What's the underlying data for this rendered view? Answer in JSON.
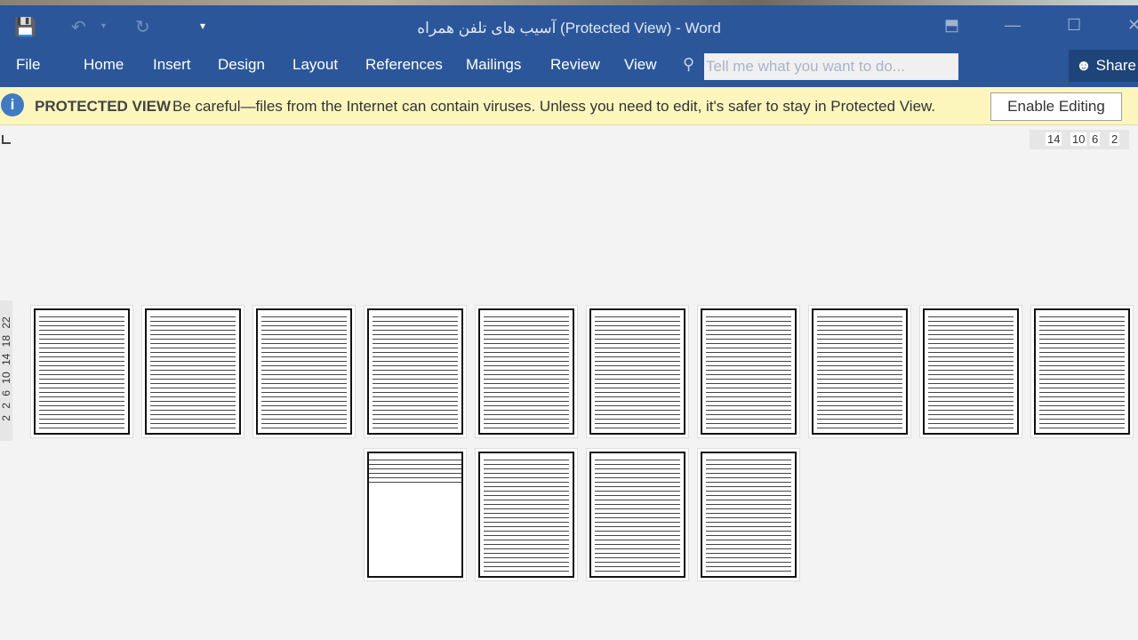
{
  "window": {
    "title": "آسیب های تلفن همراه (Protected View) - Word"
  },
  "quick_access": {
    "save": "save-icon",
    "undo": "undo-icon",
    "redo": "redo-icon",
    "customize": "customize-icon"
  },
  "ribbon": {
    "tabs": [
      "File",
      "Home",
      "Insert",
      "Design",
      "Layout",
      "References",
      "Mailings",
      "Review",
      "View"
    ],
    "tell_me_placeholder": "Tell me what you want to do...",
    "share_label": "Share"
  },
  "protected_view": {
    "label": "PROTECTED VIEW",
    "message": "Be careful—files from the Internet can contain viruses. Unless you need to edit, it's safer to stay in Protected View.",
    "button": "Enable Editing"
  },
  "rulers": {
    "horizontal": [
      "14",
      "10",
      "6",
      "2"
    ],
    "vertical": "2 2 6 10 14 18 22"
  },
  "document": {
    "page_count": 14,
    "accent": "#2b579a"
  }
}
